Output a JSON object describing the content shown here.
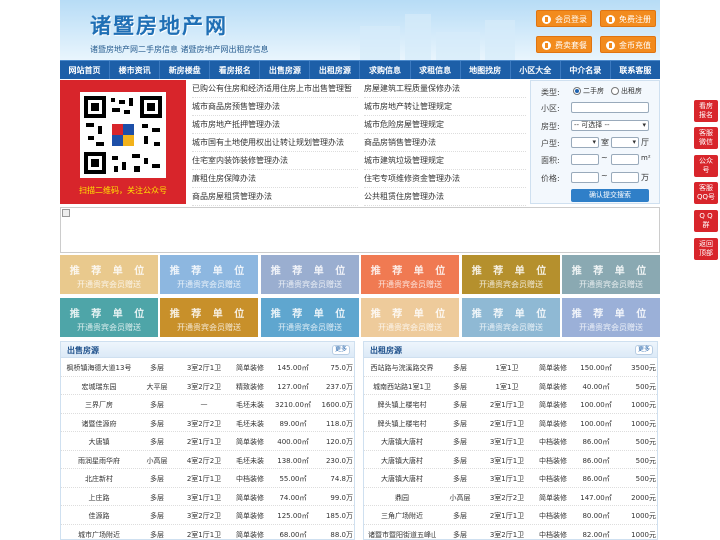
{
  "header": {
    "title": "诸暨房地产网",
    "subtitle": "诸暨房地产网二手房信息   诸暨房地产网出租房信息",
    "buttons": [
      {
        "label": "会员登录"
      },
      {
        "label": "免费注册"
      },
      {
        "label": "费卖套餐"
      },
      {
        "label": "金币充值"
      }
    ]
  },
  "nav": [
    "网站首页",
    "楼市资讯",
    "新房楼盘",
    "看房报名",
    "出售房源",
    "出租房源",
    "求购信息",
    "求租信息",
    "地图找房",
    "小区大全",
    "中介名录",
    "联系客服"
  ],
  "qr": {
    "caption": "扫描二维码，关注公众号"
  },
  "links": {
    "left": [
      "已购公有住房和经济适用住房上市出售管理暂",
      "城市商品房预售管理办法",
      "城市房地产抵押管理办法",
      "城市国有土地使用权出让转让规划管理办法",
      "住宅室内装饰装修管理办法",
      "廉租住房保障办法",
      "商品房屋租赁管理办法"
    ],
    "right": [
      "房屋建筑工程质量保修办法",
      "城市房地产转让管理规定",
      "城市危险房屋管理规定",
      "商品房销售管理办法",
      "城市建筑垃圾管理规定",
      "住宅专项维修资金管理办法",
      "公共租赁住房管理办法"
    ]
  },
  "search": {
    "type_label": "类型:",
    "type_options": [
      "二手房",
      "出租房"
    ],
    "community_label": "小区:",
    "community_value": "",
    "house_type_label": "房型:",
    "house_type_value": "-- 可选择 --",
    "layout_label": "户型:",
    "room_unit": "室",
    "hall_unit": "厅",
    "area_label": "面积:",
    "price_label": "价格:",
    "range_sep": "~",
    "area_unit": "m²",
    "price_unit": "万",
    "submit": "确认提交搜索"
  },
  "tiles": {
    "title": "推 荐 单 位",
    "subtitle": "开通贵宾会员赠送",
    "colors": [
      "#e9c98d",
      "#8db7e0",
      "#9aaed0",
      "#f07a52",
      "#b5902d",
      "#8aa9b2",
      "#4ea5a8",
      "#c8902a",
      "#5fa6cf",
      "#eecb9b",
      "#8fb9d4",
      "#9bb0d8"
    ]
  },
  "sale": {
    "title": "出售房源",
    "more": "更多",
    "rows": [
      [
        "枫桥镇海德大道13号",
        "多层",
        "3室2厅1卫",
        "简单装修",
        "145.00㎡",
        "75.0万"
      ],
      [
        "宏城瑞东园",
        "大平层",
        "3室2厅2卫",
        "精致装修",
        "127.00㎡",
        "237.0万"
      ],
      [
        "三界厂房",
        "多层",
        "—",
        "毛坯未装",
        "3210.00㎡",
        "1600.0万"
      ],
      [
        "诸暨佳源府",
        "多层",
        "3室2厅2卫",
        "毛坯未装",
        "89.00㎡",
        "118.0万"
      ],
      [
        "大唐镇",
        "多层",
        "2室1厅1卫",
        "简单装修",
        "400.00㎡",
        "120.0万"
      ],
      [
        "雨润星雨华府",
        "小高层",
        "4室2厅2卫",
        "毛坯未装",
        "138.00㎡",
        "230.0万"
      ],
      [
        "北庄新村",
        "多层",
        "2室1厅1卫",
        "中档装修",
        "55.00㎡",
        "74.8万"
      ],
      [
        "上庄路",
        "多层",
        "3室1厅1卫",
        "简单装修",
        "74.00㎡",
        "99.0万"
      ],
      [
        "佳源路",
        "多层",
        "3室2厅2卫",
        "简单装修",
        "125.00㎡",
        "185.0万"
      ],
      [
        "城市广场附近",
        "多层",
        "2室1厅1卫",
        "简单装修",
        "68.00㎡",
        "88.0万"
      ]
    ]
  },
  "rent": {
    "title": "出租房源",
    "more": "更多",
    "rows": [
      [
        "西站路与浣溪路交界",
        "多层",
        "1室1卫",
        "简单装修",
        "150.00㎡",
        "3500元"
      ],
      [
        "城南西站路1室1卫",
        "多层",
        "1室1卫",
        "简单装修",
        "40.00㎡",
        "500元"
      ],
      [
        "牌头镇上楼宅村",
        "多层",
        "2室1厅1卫",
        "简单装修",
        "100.00㎡",
        "1000元"
      ],
      [
        "牌头镇上楼宅村",
        "多层",
        "2室1厅1卫",
        "简单装修",
        "100.00㎡",
        "1000元"
      ],
      [
        "大唐镇大唐村",
        "多层",
        "3室1厅1卫",
        "中档装修",
        "86.00㎡",
        "500元"
      ],
      [
        "大唐镇大唐村",
        "多层",
        "3室1厅1卫",
        "中档装修",
        "86.00㎡",
        "500元"
      ],
      [
        "大唐镇大唐村",
        "多层",
        "3室1厅1卫",
        "中档装修",
        "86.00㎡",
        "500元"
      ],
      [
        "鼎园",
        "小高层",
        "3室2厅2卫",
        "简单装修",
        "147.00㎡",
        "2000元"
      ],
      [
        "三角广场附近",
        "多层",
        "2室1厅1卫",
        "中档装修",
        "80.00㎡",
        "1000元"
      ],
      [
        "诸暨市暨阳街道五峰山",
        "多层",
        "3室2厅1卫",
        "中档装修",
        "82.00㎡",
        "1000元"
      ]
    ]
  },
  "float": [
    [
      "看房",
      "报名"
    ],
    [
      "客服",
      "微信"
    ],
    [
      "公众",
      "号"
    ],
    [
      "客服",
      "QQ号"
    ],
    [
      "Q Q",
      "群"
    ],
    [
      "返回",
      "顶部"
    ]
  ]
}
